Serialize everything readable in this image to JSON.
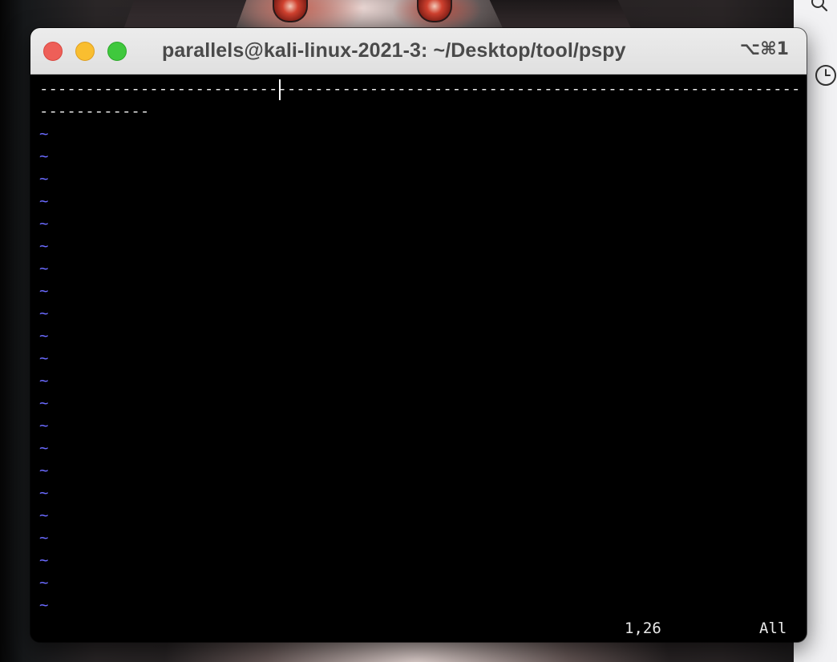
{
  "window": {
    "title": "parallels@kali-linux-2021-3: ~/Desktop/tool/pspy",
    "shortcut": "⌥⌘1",
    "buttons": {
      "close_color": "#ee5f58",
      "minimize_color": "#f9be30",
      "zoom_color": "#3fc83d"
    }
  },
  "editor": {
    "lines": [
      "-----------------------------------------------------------------------------------",
      "------------"
    ],
    "empty_line_marker": "~",
    "empty_line_color": "#6a6aff",
    "status": {
      "position": "1,26",
      "scroll": "All"
    }
  },
  "side_panel": {
    "icons": [
      "search-icon",
      "clock-icon"
    ]
  }
}
